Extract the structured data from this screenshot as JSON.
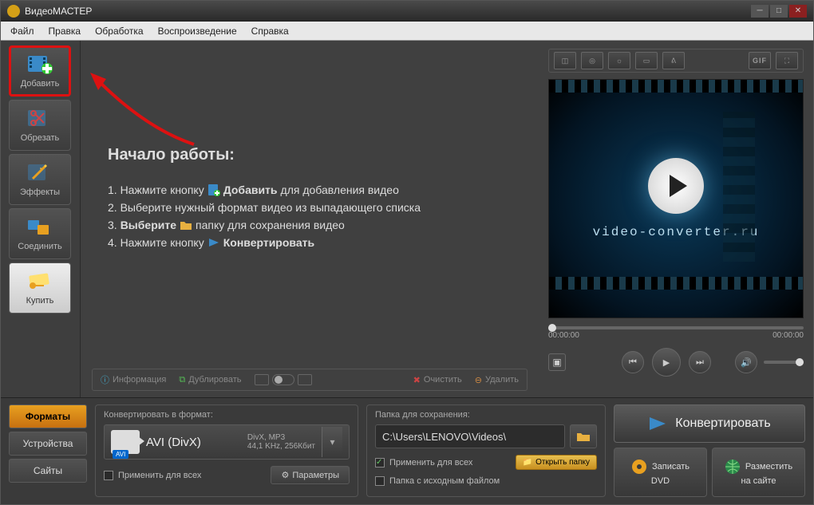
{
  "window": {
    "title": "ВидеоМАСТЕР"
  },
  "menu": {
    "file": "Файл",
    "edit": "Правка",
    "process": "Обработка",
    "play": "Воспроизведение",
    "help": "Справка"
  },
  "sidebar": {
    "add": "Добавить",
    "trim": "Обрезать",
    "effects": "Эффекты",
    "join": "Соединить",
    "buy": "Купить"
  },
  "getstarted": {
    "title": "Начало работы:",
    "l1a": "1. Нажмите кнопку ",
    "l1b": "Добавить",
    "l1c": " для добавления видео",
    "l2": "2. Выберите нужный формат видео из выпадающего списка",
    "l3a": "3. ",
    "l3b": "Выберите ",
    "l3c": "папку для сохранения видео",
    "l4a": "4. Нажмите кнопку ",
    "l4b": "Конвертировать"
  },
  "actionbar": {
    "info": "Информация",
    "dup": "Дублировать",
    "clear": "Очистить",
    "del": "Удалить"
  },
  "preview": {
    "brand": "video-converter.ru",
    "t0": "00:00:00",
    "t1": "00:00:00",
    "gif": "GIF"
  },
  "tabs": {
    "formats": "Форматы",
    "devices": "Устройства",
    "sites": "Сайты"
  },
  "format": {
    "label": "Конвертировать в формат:",
    "name": "AVI (DivX)",
    "badge": "AVI",
    "det1": "DivX, MP3",
    "det2": "44,1 KHz, 256Кбит",
    "apply": "Применить для всех",
    "params": "Параметры"
  },
  "save": {
    "label": "Папка для сохранения:",
    "path": "C:\\Users\\LENOVO\\Videos\\",
    "apply": "Применить для всех",
    "same": "Папка с исходным файлом",
    "open": "Открыть папку"
  },
  "convert": {
    "main": "Конвертировать",
    "dvd1": "Записать",
    "dvd2": "DVD",
    "site1": "Разместить",
    "site2": "на сайте"
  }
}
